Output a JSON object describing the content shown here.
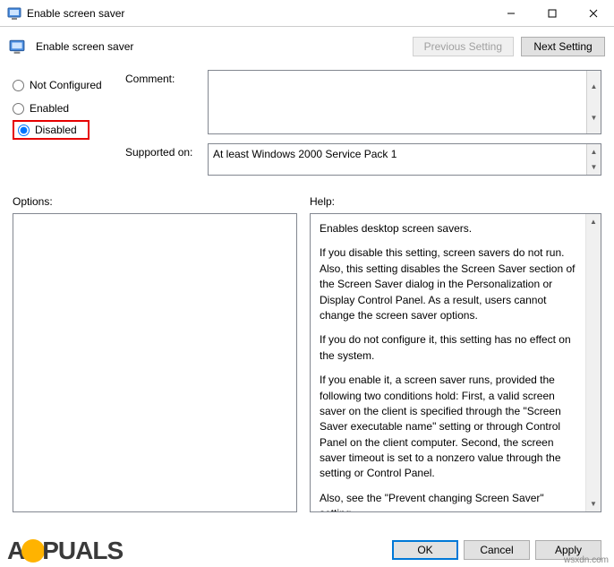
{
  "window": {
    "title": "Enable screen saver"
  },
  "toolbar": {
    "title": "Enable screen saver",
    "prev": "Previous Setting",
    "next": "Next Setting"
  },
  "radios": {
    "not_configured": "Not Configured",
    "enabled": "Enabled",
    "disabled": "Disabled"
  },
  "fields": {
    "comment_label": "Comment:",
    "comment_value": "",
    "supported_label": "Supported on:",
    "supported_value": "At least Windows 2000 Service Pack 1"
  },
  "panes": {
    "options_label": "Options:",
    "help_label": "Help:",
    "help_p1": "Enables desktop screen savers.",
    "help_p2": "If you disable this setting, screen savers do not run. Also, this setting disables the Screen Saver section of the Screen Saver dialog in the Personalization or Display Control Panel. As a result, users cannot change the screen saver options.",
    "help_p3": "If you do not configure it, this setting has no effect on the system.",
    "help_p4": "If you enable it, a screen saver runs, provided the following two conditions hold: First, a valid screen saver on the client is specified through the \"Screen Saver executable name\" setting or through Control Panel on the client computer. Second, the screen saver timeout is set to a nonzero value through the setting or Control Panel.",
    "help_p5": "Also, see the \"Prevent changing Screen Saver\" setting."
  },
  "buttons": {
    "ok": "OK",
    "cancel": "Cancel",
    "apply": "Apply"
  },
  "watermark": {
    "pre": "A",
    "post": "PUALS"
  },
  "attrib": "wsxdn.com"
}
